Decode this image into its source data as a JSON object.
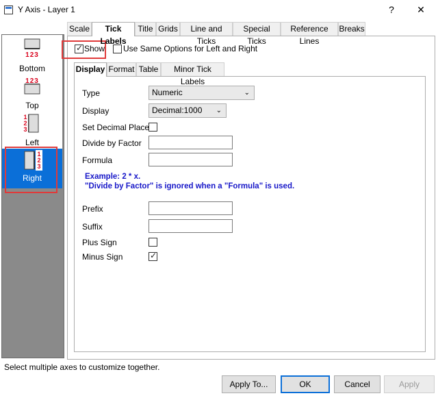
{
  "window": {
    "title": "Y Axis - Layer 1",
    "help_label": "?",
    "close_label": "✕"
  },
  "axes": [
    {
      "label": "Bottom",
      "digits": "123"
    },
    {
      "label": "Top",
      "digits": "123"
    },
    {
      "label": "Left",
      "digits": "123"
    },
    {
      "label": "Right",
      "digits": "123",
      "selected": true
    }
  ],
  "tabs": [
    "Scale",
    "Tick Labels",
    "Title",
    "Grids",
    "Line and Ticks",
    "Special Ticks",
    "Reference Lines",
    "Breaks"
  ],
  "active_tab": "Tick Labels",
  "show": {
    "label": "Show",
    "checked": true
  },
  "same_options": {
    "label": "Use Same Options for Left and Right",
    "checked": false
  },
  "subtabs": [
    "Display",
    "Format",
    "Table",
    "Minor Tick Labels"
  ],
  "active_subtab": "Display",
  "form": {
    "type_label": "Type",
    "type_value": "Numeric",
    "display_label": "Display",
    "display_value": "Decimal:1000",
    "set_decimal_label": "Set Decimal Places",
    "divide_label": "Divide by Factor",
    "divide_value": "",
    "formula_label": "Formula",
    "formula_value": "",
    "note_line1": "Example: 2 * x.",
    "note_line2": "\"Divide by Factor\" is ignored when a \"Formula\" is used.",
    "prefix_label": "Prefix",
    "prefix_value": "",
    "suffix_label": "Suffix",
    "suffix_value": "",
    "plus_sign_label": "Plus Sign",
    "plus_sign_checked": false,
    "minus_sign_label": "Minus Sign",
    "minus_sign_checked": true
  },
  "status_text": "Select multiple axes to customize together.",
  "buttons": {
    "apply_to": "Apply To...",
    "ok": "OK",
    "cancel": "Cancel",
    "apply": "Apply"
  },
  "colors": {
    "selection": "#0b6fd8",
    "highlight": "#e03a3a",
    "note": "#1616c8",
    "axis_digits": "#d9001b"
  }
}
